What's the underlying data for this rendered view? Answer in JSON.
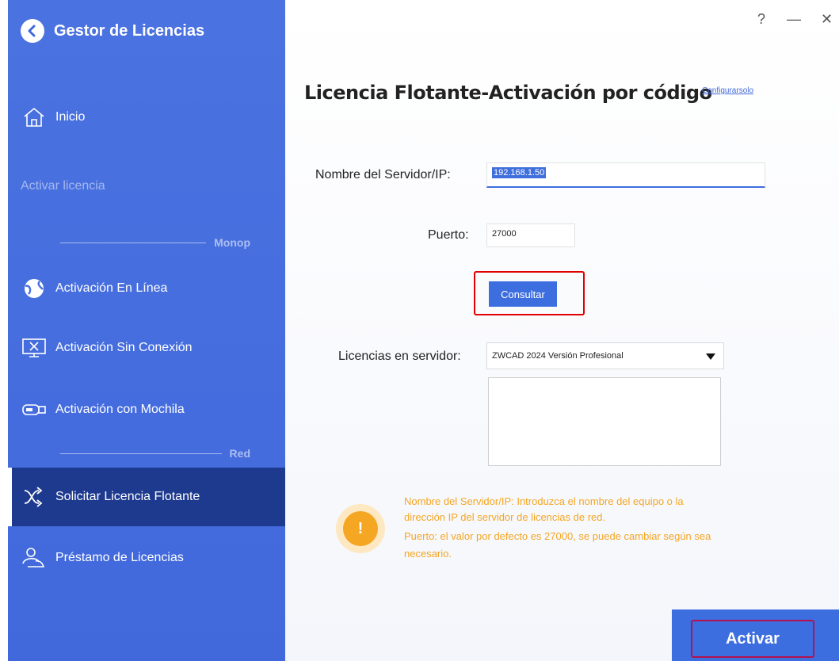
{
  "app": {
    "title": "Gestor de Licencias"
  },
  "window_controls": {
    "help": "?",
    "minimize": "—",
    "close": "✕"
  },
  "sidebar": {
    "home": "Inicio",
    "activate_header": "Activar licencia",
    "section_mono": "Monop",
    "online": "Activación En Línea",
    "offline": "Activación Sin Conexión",
    "dongle": "Activación con Mochila",
    "section_net": "Red",
    "floating": "Solicitar Licencia Flotante",
    "borrow": "Préstamo de Licencias"
  },
  "main": {
    "title": "Licencia Flotante-Activación por código",
    "config_link": "Configurarsolo",
    "server_label": "Nombre del Servidor/IP:",
    "server_value": "192.168.1.50",
    "port_label": "Puerto:",
    "port_value": "27000",
    "consult_button": "Consultar",
    "licenses_label": "Licencias en servidor:",
    "licenses_selected": "ZWCAD 2024 Versión Profesional",
    "info_icon": "!",
    "info_lines": [
      "Nombre del Servidor/IP: Introduzca el nombre del equipo o la",
      "dirección IP del servidor de licencias de red.",
      "Puerto: el valor por defecto es 27000, se puede cambiar según sea",
      "necesario."
    ],
    "activate_button": "Activar"
  },
  "colors": {
    "sidebar_bg": "#4a72e0",
    "sidebar_active": "#1e3a8f",
    "accent": "#3d6ee0",
    "warning": "#f5a623",
    "highlight": "#e00000"
  },
  "icons": [
    "back-arrow-icon",
    "home-icon",
    "globe-icon",
    "monitor-icon",
    "usb-dongle-icon",
    "network-icon",
    "users-icon",
    "warning-icon",
    "dropdown-caret-icon"
  ]
}
